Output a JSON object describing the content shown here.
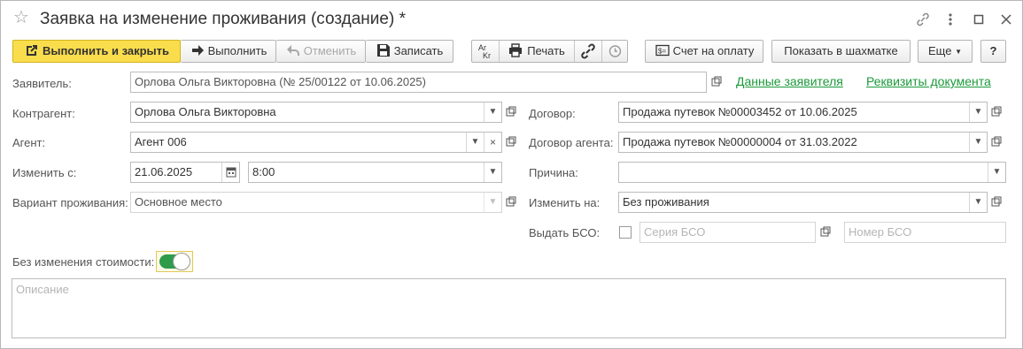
{
  "window": {
    "title": "Заявка на изменение проживания (создание) *",
    "star_icon": "star-icon",
    "controls": [
      "link-icon",
      "more-icon",
      "maximize-icon",
      "close-icon"
    ]
  },
  "toolbar": {
    "execute_close": "Выполнить и закрыть",
    "execute": "Выполнить",
    "cancel": "Отменить",
    "save": "Записать",
    "print": "Печать",
    "invoice": "Счет на оплату",
    "chess": "Показать в шахматке",
    "more": "Еще",
    "help": "?"
  },
  "applicant": {
    "label": "Заявитель:",
    "value": "Орлова Ольга Викторовна (№ 25/00122 от 10.06.2025)",
    "link_data": "Данные заявителя",
    "link_requisites": "Реквизиты документа"
  },
  "left": {
    "counterparty_label": "Контрагент:",
    "counterparty": "Орлова Ольга Викторовна",
    "agent_label": "Агент:",
    "agent": "Агент 006",
    "change_from_label": "Изменить с:",
    "date": "21.06.2025",
    "time": "8:00",
    "variant_label": "Вариант проживания:",
    "variant": "Основное место"
  },
  "right": {
    "contract_label": "Договор:",
    "contract": "Продажа путевок №00003452 от 10.06.2025",
    "agent_contract_label": "Договор агента:",
    "agent_contract": "Продажа путевок №00000004 от 31.03.2022",
    "reason_label": "Причина:",
    "reason": "",
    "change_to_label": "Изменить на:",
    "change_to": "Без проживания",
    "bso_label": "Выдать БСО:",
    "bso_series_ph": "Серия БСО",
    "bso_number_ph": "Номер БСО"
  },
  "no_cost_change": {
    "label": "Без изменения стоимости:",
    "enabled": true
  },
  "description": {
    "placeholder": "Описание"
  },
  "colors": {
    "primary_button": "#fadd4d",
    "link": "#1a9a3a",
    "toggle_on": "#2e9c4b"
  }
}
